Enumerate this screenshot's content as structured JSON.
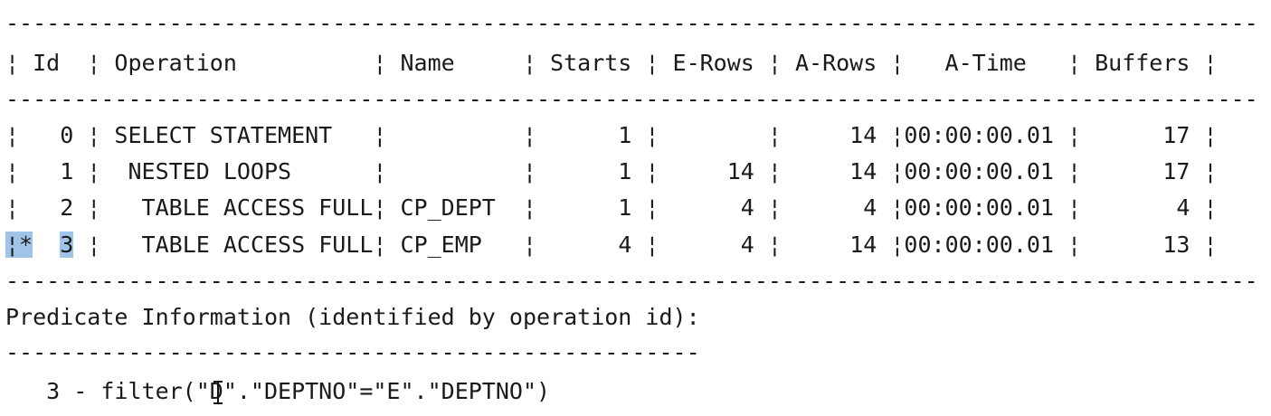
{
  "plan": {
    "separator_top": "--------------------------------------------------------------------------------------------",
    "header": "¦ Id  ¦ Operation          ¦ Name     ¦ Starts ¦ E-Rows ¦ A-Rows ¦   A-Time   ¦ Buffers ¦",
    "separator_mid": "--------------------------------------------------------------------------------------------",
    "rows": [
      "¦   0 ¦ SELECT STATEMENT   ¦          ¦      1 ¦        ¦     14 ¦00:00:00.01 ¦      17 ¦",
      "¦   1 ¦  NESTED LOOPS      ¦          ¦      1 ¦     14 ¦     14 ¦00:00:00.01 ¦      17 ¦",
      "¦   2 ¦   TABLE ACCESS FULL¦ CP_DEPT  ¦      1 ¦      4 ¦      4 ¦00:00:00.01 ¦       4 ¦"
    ],
    "row3": {
      "selected_prefix": "¦*",
      "gap": "  ",
      "selected_id": "3",
      "rest": " ¦   TABLE ACCESS FULL¦ CP_EMP   ¦      4 ¦      4 ¦     14 ¦00:00:00.01 ¦      13 ¦"
    },
    "separator_bottom": "--------------------------------------------------------------------------------------------"
  },
  "predicate": {
    "title": "Predicate Information (identified by operation id):",
    "separator": "---------------------------------------------------",
    "line": "   3 - filter(\"D\".\"DEPTNO\"=\"E\".\"DEPTNO\")"
  },
  "colors": {
    "background": "#ffffff",
    "text": "#1a1a1a",
    "selection": "#9fc4e8"
  }
}
